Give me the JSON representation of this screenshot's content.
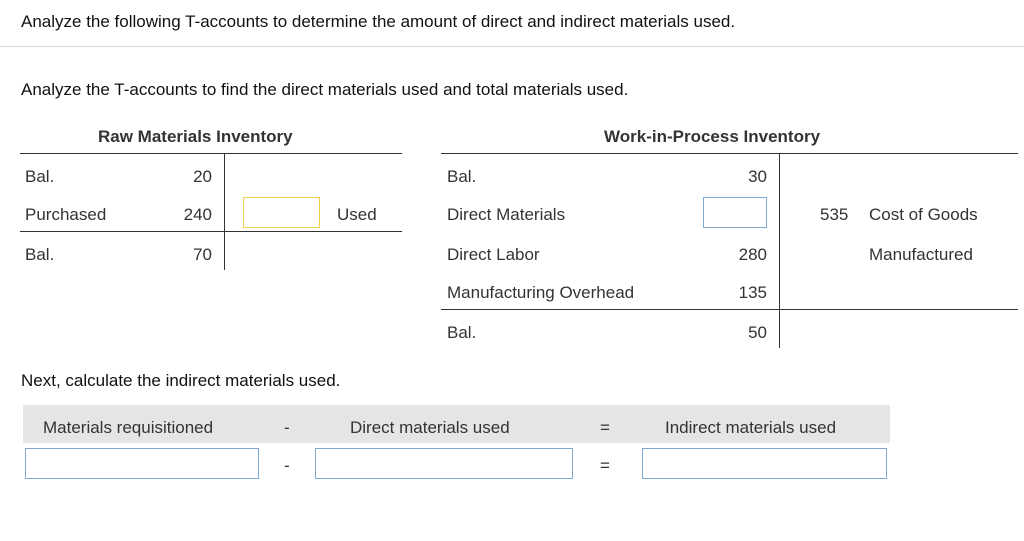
{
  "question": {
    "title": "Analyze the following T-accounts to determine the amount of direct and indirect materials used.",
    "instruction": "Analyze the T-accounts to find the direct materials used and total materials used."
  },
  "raw_materials": {
    "title": "Raw Materials Inventory",
    "rows": [
      {
        "label": "Bal.",
        "value": "20"
      },
      {
        "label": "Purchased",
        "value": "240"
      },
      {
        "label": "Bal.",
        "value": "70"
      }
    ],
    "credit_input_value": "",
    "credit_label": "Used"
  },
  "wip": {
    "title": "Work-in-Process Inventory",
    "rows": [
      {
        "label": "Bal.",
        "value": "30"
      },
      {
        "label": "Direct Materials",
        "value": ""
      },
      {
        "label": "Direct Labor",
        "value": "280"
      },
      {
        "label": "Manufacturing Overhead",
        "value": "135"
      },
      {
        "label": "Bal.",
        "value": "50"
      }
    ],
    "direct_materials_input_value": "",
    "credit_value": "535",
    "credit_label_line1": "Cost of Goods",
    "credit_label_line2": "Manufactured"
  },
  "indirect": {
    "instruction": "Next, calculate the indirect materials used.",
    "headers": {
      "col1": "Materials requisitioned",
      "op1": "-",
      "col2": "Direct materials used",
      "op2": "=",
      "col3": "Indirect materials used"
    },
    "inputs": {
      "col1": "",
      "col2": "",
      "col3": ""
    },
    "ops": {
      "op1": "-",
      "op2": "="
    }
  },
  "colors": {
    "input_border": "#7fa7cf",
    "highlight_border": "#f0d24a",
    "header_bg": "#e5e5e5"
  }
}
